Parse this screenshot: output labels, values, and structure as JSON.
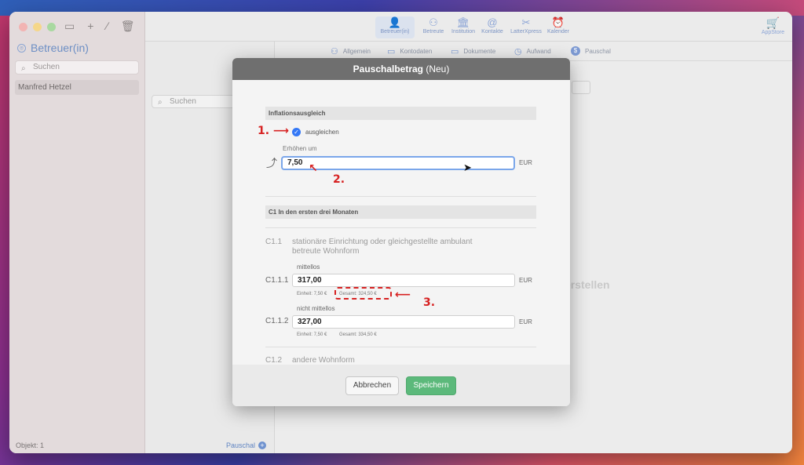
{
  "sidebar": {
    "title": "Betreuer(in)",
    "search_placeholder": "Suchen",
    "items": [
      {
        "label": "Manfred Hetzel"
      }
    ],
    "footer": "Objekt: 1"
  },
  "midcol": {
    "search_placeholder": "Suchen",
    "footer_label": "Pauschal"
  },
  "toolbar": {
    "items": [
      {
        "label": "Betreuer(in)",
        "icon": "person-icon"
      },
      {
        "label": "Betreute",
        "icon": "person-outline-icon"
      },
      {
        "label": "Institution",
        "icon": "building-icon"
      },
      {
        "label": "Kontakte",
        "icon": "contacts-icon"
      },
      {
        "label": "LatterXpress",
        "icon": "scissors-icon"
      },
      {
        "label": "Kalender",
        "icon": "alarm-icon"
      }
    ],
    "appstore": "AppStore"
  },
  "tabs": [
    {
      "label": "Allgemein"
    },
    {
      "label": "Kontodaten"
    },
    {
      "label": "Dokumente"
    },
    {
      "label": "Aufwand"
    },
    {
      "label": "Pauschal"
    }
  ],
  "background_text": "erstellen",
  "modal": {
    "title_bold": "Pauschalbetrag",
    "title_rest": " (Neu)",
    "inflation": {
      "header": "Inflationsausgleich",
      "checkbox_label": "ausgleichen",
      "checked": true,
      "increase_label": "Erhöhen um",
      "increase_value": "7,50",
      "currency": "EUR"
    },
    "c1": {
      "header": "C1 In den ersten drei Monaten",
      "c11_code": "C1.1",
      "c11_desc": "stationäre Einrichtung oder gleichgestellte ambulant betreute Wohnform",
      "mittellos_label": "mittellos",
      "c111_code": "C1.1.1",
      "c111_value": "317,00",
      "c111_unit": "Einheit: 7,50 €",
      "c111_total": "Gesamt: 324,50 €",
      "nicht_mittellos_label": "nicht mittellos",
      "c112_code": "C1.1.2",
      "c112_value": "327,00",
      "c112_unit": "Einheit: 7,50 €",
      "c112_total": "Gesamt: 334,50 €",
      "c12_code": "C1.2",
      "c12_desc": "andere Wohnform",
      "currency": "EUR"
    },
    "buttons": {
      "cancel": "Abbrechen",
      "save": "Speichern"
    }
  },
  "annotations": {
    "one": "1.",
    "two": "2.",
    "three": "3."
  },
  "colors": {
    "accent": "#3478f6",
    "save": "#5cb97b",
    "annotation": "#d72222"
  }
}
